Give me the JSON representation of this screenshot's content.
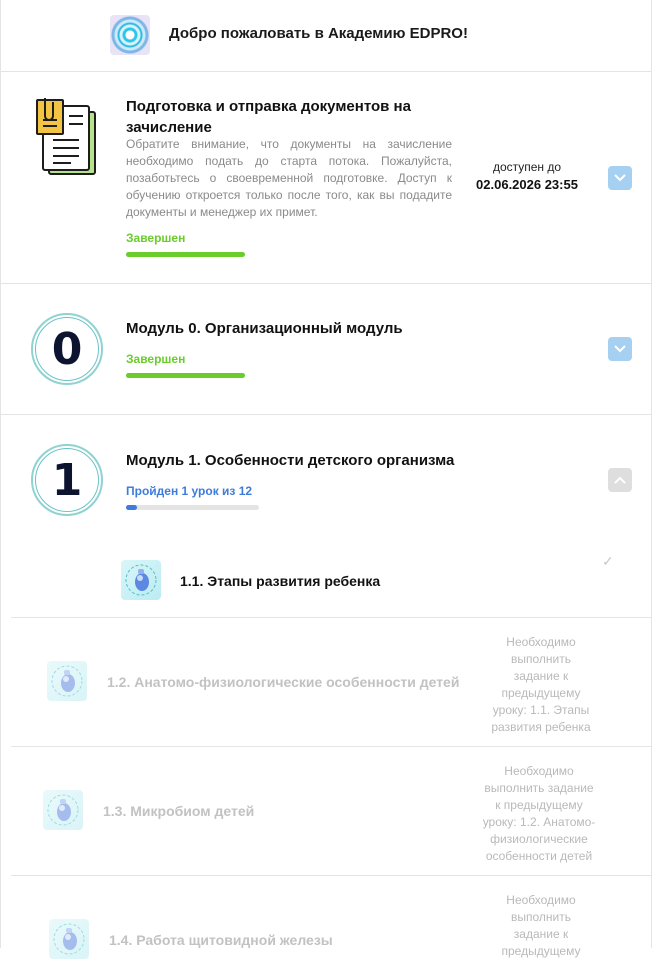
{
  "welcome": {
    "title": "Добро пожаловать в Академию EDPRO!",
    "logo_icon": "academy-logo-icon"
  },
  "docs": {
    "title_line1": "Подготовка и отправка документов на",
    "title_line2": "зачисление",
    "description": "Обратите внимание, что документы на зачисление необходимо подать до старта потока. Пожалуйста, позаботьтесь о своевременной подготовке. Доступ к обучению откроется только после того, как вы подадите документы и менеджер их примет.",
    "status": "Завершен",
    "progress": 1.0,
    "available_label": "доступен до",
    "available_date": "02.06.2026 23:55",
    "icon": "documents-icon"
  },
  "module0": {
    "number": "0",
    "title": "Модуль 0. Организационный модуль",
    "status": "Завершен",
    "progress": 1.0
  },
  "module1": {
    "number": "1",
    "title": "Модуль 1. Особенности детского организма",
    "progress_text": "Пройден 1 урок из 12",
    "progress": 0.0833,
    "lessons": [
      {
        "title": "1.1. Этапы развития ребенка",
        "completed": true,
        "requirement": ""
      },
      {
        "title": "1.2. Анатомо-физиологические особенности детей",
        "completed": false,
        "req_lines": [
          "Необходимо",
          "выполнить",
          "задание к",
          "предыдущему",
          "уроку: 1.1. Этапы",
          "развития ребенка"
        ]
      },
      {
        "title": "1.3. Микробиом детей",
        "completed": false,
        "req_lines": [
          "Необходимо",
          "выполнить задание",
          "к предыдущему",
          "уроку: 1.2. Анатомо-",
          "физиологические",
          "особенности детей"
        ]
      },
      {
        "title": "1.4. Работа щитовидной железы",
        "completed": false,
        "req_lines": [
          "Необходимо",
          "выполнить",
          "задание к",
          "предыдущему"
        ]
      }
    ]
  },
  "colors": {
    "done_green": "#6acd2b",
    "progress_blue": "#3d7cdb",
    "chevron_blue": "#a6d0f2"
  }
}
